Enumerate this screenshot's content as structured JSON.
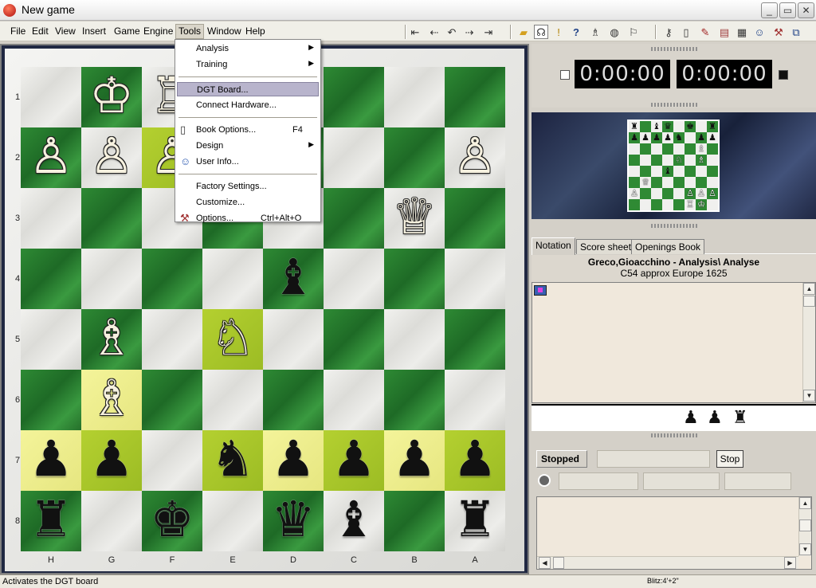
{
  "window": {
    "title": "New game",
    "min": "_",
    "max": "▭",
    "close": "✕"
  },
  "menubar": [
    "File",
    "Edit",
    "View",
    "Insert",
    "Game",
    "Engine",
    "Tools",
    "Window",
    "Help"
  ],
  "toolbar_icons": [
    "first-move-icon",
    "prev-move-icon",
    "back-icon",
    "forward-icon",
    "last-move-icon",
    "folder-icon",
    "headset-icon",
    "warning-icon",
    "help-question-icon",
    "figure-icon",
    "globe-icon",
    "flag-icon",
    "key-icon",
    "book-icon",
    "pen-icon",
    "card-icon",
    "board-icon",
    "user-icon",
    "tools-icon",
    "window-icon"
  ],
  "tools_menu": [
    {
      "label": "Analysis",
      "submenu": true
    },
    {
      "label": "Training",
      "submenu": true
    },
    {
      "sep": true
    },
    {
      "label": "DGT Board...",
      "highlighted": true
    },
    {
      "label": "Connect Hardware..."
    },
    {
      "sep": true
    },
    {
      "label": "Book Options...",
      "shortcut": "F4",
      "icon": "book-icon"
    },
    {
      "label": "Design",
      "submenu": true
    },
    {
      "label": "User Info...",
      "icon": "user-icon"
    },
    {
      "sep": true
    },
    {
      "label": "Factory Settings..."
    },
    {
      "label": "Customize..."
    },
    {
      "label": "Options...",
      "shortcut": "Ctrl+Alt+O",
      "icon": "tools-icon"
    }
  ],
  "board": {
    "ranks": [
      "1",
      "2",
      "3",
      "4",
      "5",
      "6",
      "7",
      "8"
    ],
    "files": [
      "H",
      "G",
      "F",
      "E",
      "D",
      "C",
      "B",
      "A"
    ],
    "pieces": [
      {
        "sq": "g1",
        "p": "K",
        "c": "w"
      },
      {
        "sq": "f1",
        "p": "R",
        "c": "w"
      },
      {
        "sq": "h2",
        "p": "P",
        "c": "w"
      },
      {
        "sq": "g2",
        "p": "P",
        "c": "w"
      },
      {
        "sq": "f2",
        "p": "P",
        "c": "w"
      },
      {
        "sq": "a2",
        "p": "P",
        "c": "w"
      },
      {
        "sq": "b3",
        "p": "Q",
        "c": "w"
      },
      {
        "sq": "d4",
        "p": "B",
        "c": "b"
      },
      {
        "sq": "g5",
        "p": "B",
        "c": "w"
      },
      {
        "sq": "e5",
        "p": "N",
        "c": "w"
      },
      {
        "sq": "g6",
        "p": "B",
        "c": "w"
      },
      {
        "sq": "h7",
        "p": "P",
        "c": "b"
      },
      {
        "sq": "g7",
        "p": "P",
        "c": "b"
      },
      {
        "sq": "e7",
        "p": "N",
        "c": "b"
      },
      {
        "sq": "d7",
        "p": "P",
        "c": "b"
      },
      {
        "sq": "c7",
        "p": "P",
        "c": "b"
      },
      {
        "sq": "b7",
        "p": "P",
        "c": "b"
      },
      {
        "sq": "a7",
        "p": "P",
        "c": "b"
      },
      {
        "sq": "h8",
        "p": "R",
        "c": "b"
      },
      {
        "sq": "f8",
        "p": "K",
        "c": "b"
      },
      {
        "sq": "d8",
        "p": "Q",
        "c": "b"
      },
      {
        "sq": "c8",
        "p": "B",
        "c": "b"
      },
      {
        "sq": "a8",
        "p": "R",
        "c": "b"
      }
    ],
    "highlighted": [
      "f2",
      "e5",
      "g6",
      "h7",
      "g7",
      "e7",
      "d7",
      "c7",
      "b7",
      "a7"
    ]
  },
  "clocks": {
    "white": "0:00:00",
    "black": "0:00:00"
  },
  "tabs": [
    "Notation",
    "Score sheet",
    "Openings Book"
  ],
  "game_header": {
    "players": "Greco,Gioacchino - Analysis\\ Analyse",
    "eco": "C54  approx Europe 1625"
  },
  "captured": [
    "♟",
    "♟",
    "♜"
  ],
  "engine": {
    "status": "Stopped",
    "stop_label": "Stop"
  },
  "statusbar": {
    "left": "Activates the DGT board",
    "right": "Blitz:4'+2\""
  },
  "colors": {
    "dark_square": "#2e8a34",
    "light_square": "#ececea",
    "highlight": "#e6e680",
    "accent": "#b8b4cc"
  }
}
